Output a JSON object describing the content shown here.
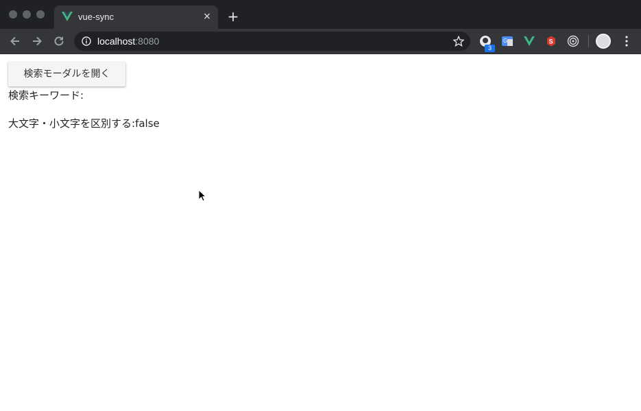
{
  "browser": {
    "tab_title": "vue-sync",
    "tab_close": "×",
    "new_tab": "+",
    "url_host": "localhost",
    "url_port": ":8080",
    "extension_badge": "3"
  },
  "page": {
    "open_modal_button": "検索モーダルを開く",
    "search_keyword_label": "検索キーワード:",
    "search_keyword_value": "",
    "case_sensitive_label": "大文字・小文字を区別する:",
    "case_sensitive_value": "false"
  },
  "colors": {
    "vue_green": "#41b883",
    "chrome_dark": "#202124",
    "toolbar": "#35363a"
  }
}
